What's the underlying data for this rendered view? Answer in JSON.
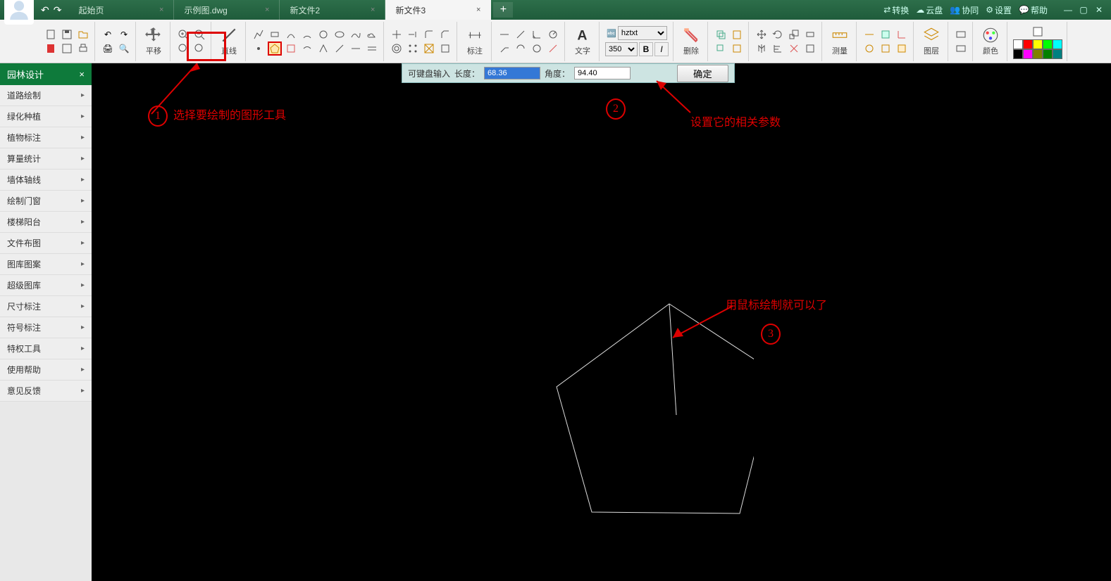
{
  "tabs": [
    {
      "label": "起始页",
      "active": false
    },
    {
      "label": "示例图.dwg",
      "active": false
    },
    {
      "label": "新文件2",
      "active": false
    },
    {
      "label": "新文件3",
      "active": true
    }
  ],
  "title_right": {
    "convert": "转换",
    "cloud": "云盘",
    "coop": "协同",
    "settings": "设置",
    "help": "帮助"
  },
  "ribbon": {
    "pan": "平移",
    "line": "直线",
    "annotate": "标注",
    "text": "文字",
    "delete": "删除",
    "measure": "测量",
    "layer": "图层",
    "color": "颜色",
    "font": "hztxt",
    "size": "350",
    "bold": "B",
    "italic": "I"
  },
  "swatches": [
    "#ffffff",
    "#ff0000",
    "#ffff00",
    "#00ff00",
    "#00ffff",
    "#0000ff",
    "#000000",
    "#ff00ff",
    "#808000",
    "#008000"
  ],
  "sidebar": {
    "header": "园林设计",
    "items": [
      "道路绘制",
      "绿化种植",
      "植物标注",
      "算量统计",
      "墙体轴线",
      "绘制门窗",
      "楼梯阳台",
      "文件布图",
      "图库图案",
      "超级图库",
      "尺寸标注",
      "符号标注",
      "特权工具",
      "使用帮助",
      "意见反馈"
    ]
  },
  "input_bar": {
    "hint": "可键盘输入",
    "length_label": "长度：",
    "length_value": "68.36",
    "angle_label": "角度：",
    "angle_value": "94.40",
    "confirm": "确定"
  },
  "annotations": {
    "a1_num": "1",
    "a1_text": "选择要绘制的图形工具",
    "a2_num": "2",
    "a2_text": "设置它的相关参数",
    "a3_num": "3",
    "a3_text": "用鼠标绘制就可以了"
  }
}
